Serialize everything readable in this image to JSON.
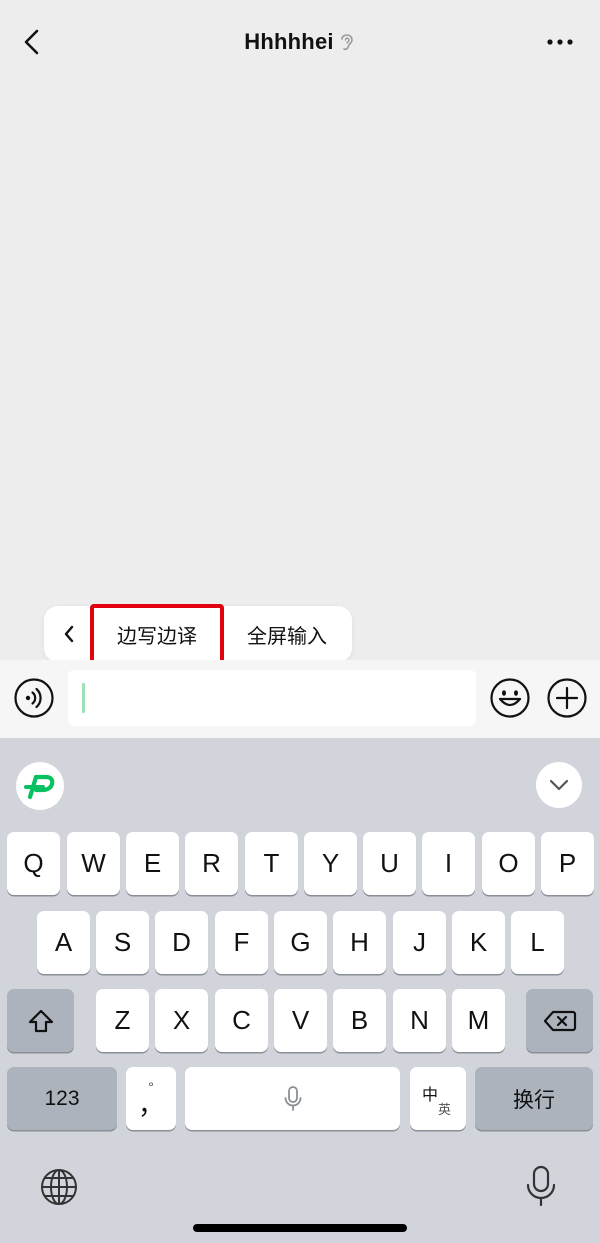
{
  "header": {
    "title": "Hhhhhei",
    "icons": {
      "back": "chevron-left-icon",
      "ear": "ear-icon",
      "more": "more-dots-icon"
    }
  },
  "popover": {
    "items": [
      {
        "label": "边写边译",
        "highlighted": true
      },
      {
        "label": "全屏输入"
      }
    ],
    "highlight_color": "#e3000f"
  },
  "input_bar": {
    "value": "",
    "placeholder": "",
    "accent_caret": "#07c160"
  },
  "keyboard": {
    "rows": {
      "row1": [
        "Q",
        "W",
        "E",
        "R",
        "T",
        "Y",
        "U",
        "I",
        "O",
        "P"
      ],
      "row2": [
        "A",
        "S",
        "D",
        "F",
        "G",
        "H",
        "J",
        "K",
        "L"
      ],
      "row3": [
        "Z",
        "X",
        "C",
        "V",
        "B",
        "N",
        "M"
      ]
    },
    "bottom_row": {
      "numbers_label": "123",
      "punct_top": "°",
      "punct_main": "，",
      "lang_top": "中",
      "lang_bottom": "英",
      "return_label": "换行"
    },
    "colors": {
      "background": "#d1d4db",
      "key": "#ffffff",
      "dark_key": "#adb3bd",
      "logo": "#07c160"
    }
  }
}
